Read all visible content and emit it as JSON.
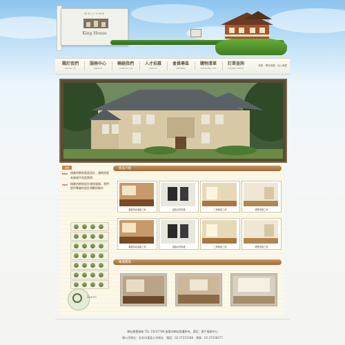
{
  "header": {
    "logo_top": "WELCOME",
    "logo_text": "King House"
  },
  "nav": {
    "items": [
      {
        "zh": "關於我們",
        "en": "ABOUT US"
      },
      {
        "zh": "服務中心",
        "en": "SERVICE"
      },
      {
        "zh": "聯絡我們",
        "en": "CONTACT US"
      },
      {
        "zh": "人才招募",
        "en": "JOIN US"
      },
      {
        "zh": "會員專區",
        "en": "MEMBER"
      },
      {
        "zh": "購物清單",
        "en": "SHOPPING LIST"
      },
      {
        "zh": "訂單查詢",
        "en": "ORDER CHECK"
      }
    ],
    "quick_links": "首頁 · 網站地圖 · 加入最愛"
  },
  "news": {
    "tag": "最新",
    "items": [
      {
        "badge": "NEW",
        "text": "精美的網頁版面設計，讓網頁更有質感不再是夢想"
      },
      {
        "badge": "NEW",
        "text": "精美的網頁設計連結服務，我們提供專業的設計規劃與製作"
      }
    ]
  },
  "sidebar_links": [
    "",
    "",
    "",
    "",
    "",
    "",
    "",
    ""
  ],
  "search_label": "Search",
  "sections": {
    "products_title": "新品介紹",
    "gallery_title": "精選實景"
  },
  "products": [
    {
      "caption": "森藍時尚溫馨三房"
    },
    {
      "caption": "溫馨北歐風格"
    },
    {
      "caption": "三房雅致三房"
    },
    {
      "caption": "輕奢風格三房"
    },
    {
      "caption": "森藍時尚溫馨三房"
    },
    {
      "caption": "溫馨北歐風格"
    },
    {
      "caption": "三房雅致三房"
    },
    {
      "caption": "輕奢風格三房"
    }
  ],
  "footer": {
    "line1": "網站建置服務 TEL 10247788 查看你網站版權所有，請至：客戶服務中心",
    "line2": "總公司地址：台北市某區公司地址　電話：02-27223188　傳真：02-27238277"
  },
  "colors": {
    "accent": "#a06a38",
    "sky": "#8cc4ef",
    "paper": "#fbf8ea"
  }
}
